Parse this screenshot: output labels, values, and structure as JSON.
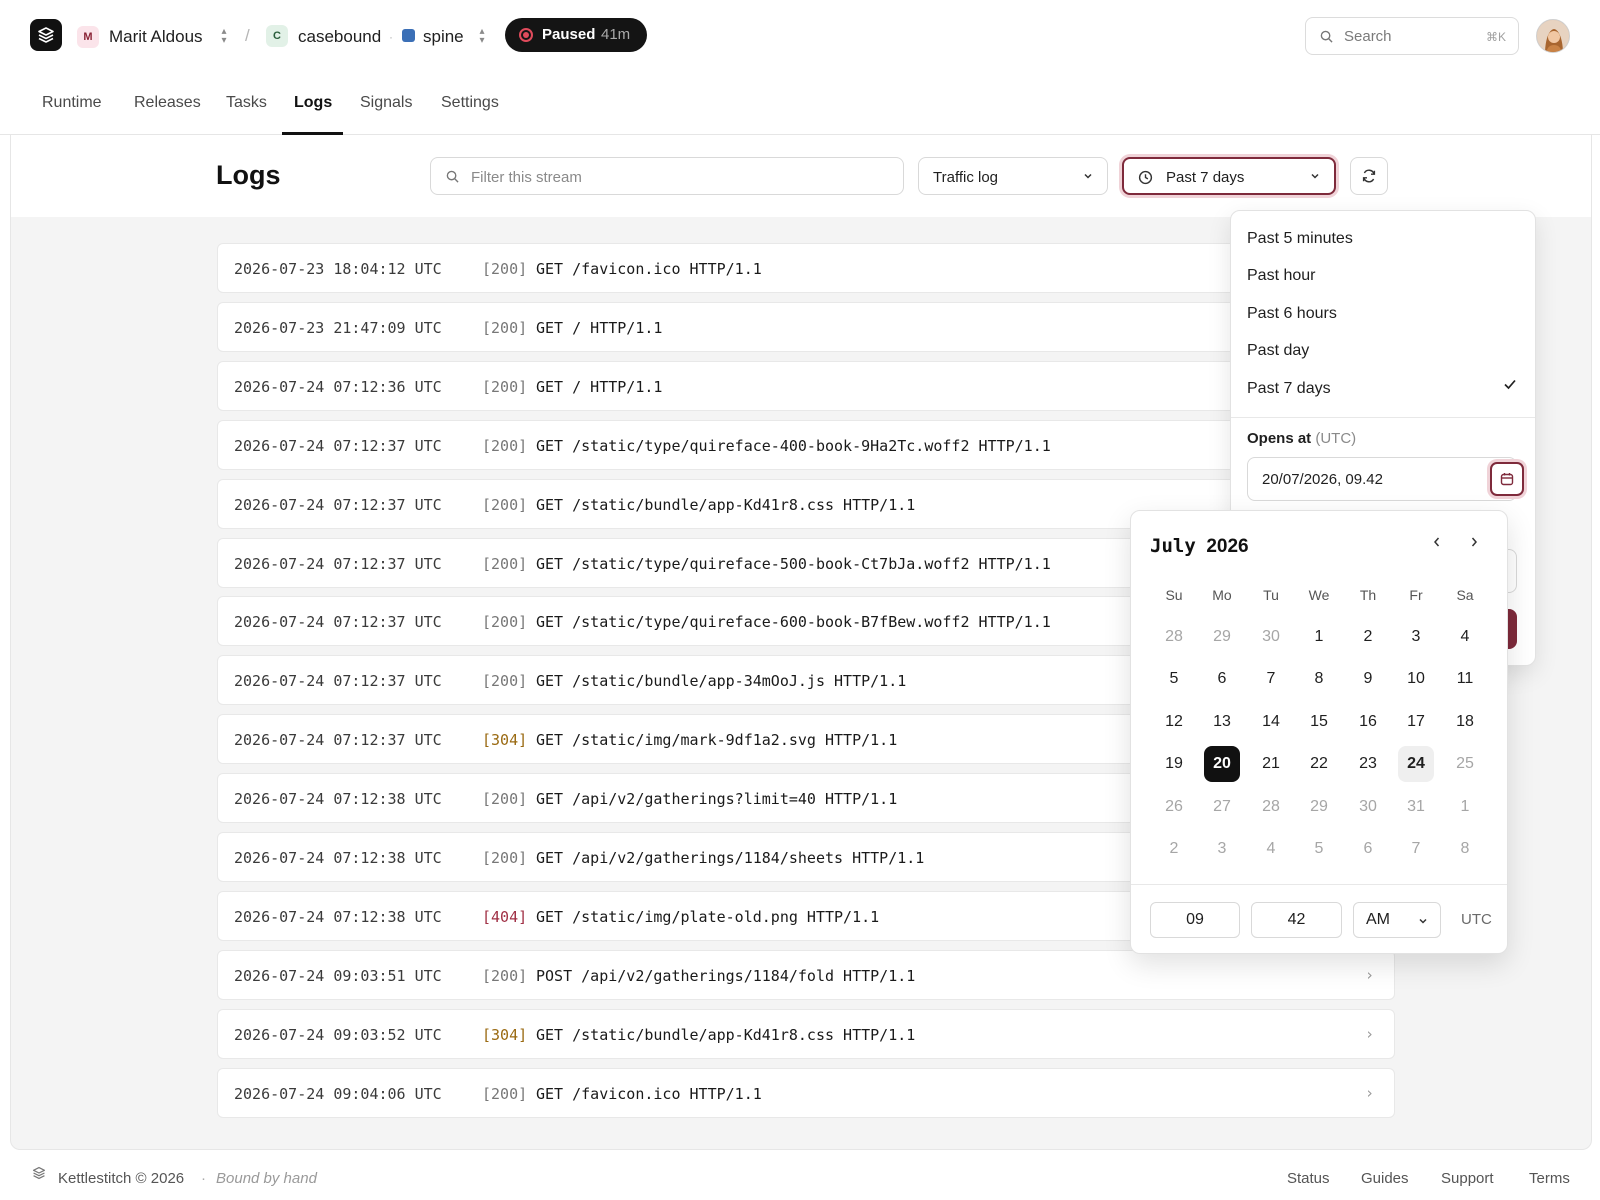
{
  "app": {
    "workspace": "Marit Aldous",
    "workspace_initial": "M",
    "project": "casebound",
    "project_initial": "C",
    "service": "spine",
    "status_label": "Paused",
    "status_duration": "41m",
    "search_placeholder": "Search",
    "search_shortcut": "⌘K"
  },
  "nav": {
    "tabs": [
      {
        "label": "Runtime"
      },
      {
        "label": "Releases"
      },
      {
        "label": "Tasks"
      },
      {
        "label": "Logs"
      },
      {
        "label": "Signals"
      },
      {
        "label": "Settings"
      }
    ],
    "active": "Logs"
  },
  "logs": {
    "title": "Logs",
    "filter_placeholder": "Filter this stream",
    "stream_select": "Traffic log",
    "range_select": "Past 7 days",
    "rows": [
      {
        "ts": "2026-07-23 18:04:12 UTC",
        "status": "[200]",
        "req": "GET /favicon.ico HTTP/1.1"
      },
      {
        "ts": "2026-07-23 21:47:09 UTC",
        "status": "[200]",
        "req": "GET / HTTP/1.1"
      },
      {
        "ts": "2026-07-24 07:12:36 UTC",
        "status": "[200]",
        "req": "GET / HTTP/1.1"
      },
      {
        "ts": "2026-07-24 07:12:37 UTC",
        "status": "[200]",
        "req": "GET /static/type/quireface-400-book-9Ha2Tc.woff2 HTTP/1.1"
      },
      {
        "ts": "2026-07-24 07:12:37 UTC",
        "status": "[200]",
        "req": "GET /static/bundle/app-Kd41r8.css HTTP/1.1"
      },
      {
        "ts": "2026-07-24 07:12:37 UTC",
        "status": "[200]",
        "req": "GET /static/type/quireface-500-book-Ct7bJa.woff2 HTTP/1.1"
      },
      {
        "ts": "2026-07-24 07:12:37 UTC",
        "status": "[200]",
        "req": "GET /static/type/quireface-600-book-B7fBew.woff2 HTTP/1.1"
      },
      {
        "ts": "2026-07-24 07:12:37 UTC",
        "status": "[200]",
        "req": "GET /static/bundle/app-34mOoJ.js HTTP/1.1"
      },
      {
        "ts": "2026-07-24 07:12:37 UTC",
        "status": "[304]",
        "req": "GET /static/img/mark-9df1a2.svg HTTP/1.1"
      },
      {
        "ts": "2026-07-24 07:12:38 UTC",
        "status": "[200]",
        "req": "GET /api/v2/gatherings?limit=40 HTTP/1.1"
      },
      {
        "ts": "2026-07-24 07:12:38 UTC",
        "status": "[200]",
        "req": "GET /api/v2/gatherings/1184/sheets HTTP/1.1"
      },
      {
        "ts": "2026-07-24 07:12:38 UTC",
        "status": "[404]",
        "req": "GET /static/img/plate-old.png HTTP/1.1"
      },
      {
        "ts": "2026-07-24 09:03:51 UTC",
        "status": "[200]",
        "req": "POST /api/v2/gatherings/1184/fold HTTP/1.1"
      },
      {
        "ts": "2026-07-24 09:03:52 UTC",
        "status": "[304]",
        "req": "GET /static/bundle/app-Kd41r8.css HTTP/1.1"
      },
      {
        "ts": "2026-07-24 09:04:06 UTC",
        "status": "[200]",
        "req": "GET /favicon.ico HTTP/1.1"
      }
    ]
  },
  "range_menu": {
    "options": [
      "Past 5 minutes",
      "Past hour",
      "Past 6 hours",
      "Past day",
      "Past 7 days"
    ],
    "selected": "Past 7 days",
    "opens_label": "Opens at",
    "opens_tz": "(UTC)",
    "opens_value": "20/07/2026, 09.42"
  },
  "calendar": {
    "month": "July",
    "year": "2026",
    "weekdays": [
      "Su",
      "Mo",
      "Tu",
      "We",
      "Th",
      "Fr",
      "Sa"
    ],
    "weeks": [
      [
        "28",
        "29",
        "30",
        "1",
        "2",
        "3",
        "4"
      ],
      [
        "5",
        "6",
        "7",
        "8",
        "9",
        "10",
        "11"
      ],
      [
        "12",
        "13",
        "14",
        "15",
        "16",
        "17",
        "18"
      ],
      [
        "19",
        "20",
        "21",
        "22",
        "23",
        "24",
        "25"
      ],
      [
        "26",
        "27",
        "28",
        "29",
        "30",
        "31",
        "1"
      ],
      [
        "2",
        "3",
        "4",
        "5",
        "6",
        "7",
        "8"
      ]
    ],
    "selected_day": "20",
    "today_day": "24",
    "hour": "09",
    "minute": "42",
    "meridiem": "AM",
    "timezone": "UTC"
  },
  "footer": {
    "brand": "Kettlestitch © 2026",
    "separator": "·",
    "tagline": "Bound by hand",
    "links": [
      "Status",
      "Guides",
      "Support",
      "Terms"
    ]
  },
  "colors": {
    "accent": "#7e2a3b",
    "status_304": "#9a6a12",
    "status_404": "#a03045",
    "paused_dot": "#e04b5c"
  }
}
